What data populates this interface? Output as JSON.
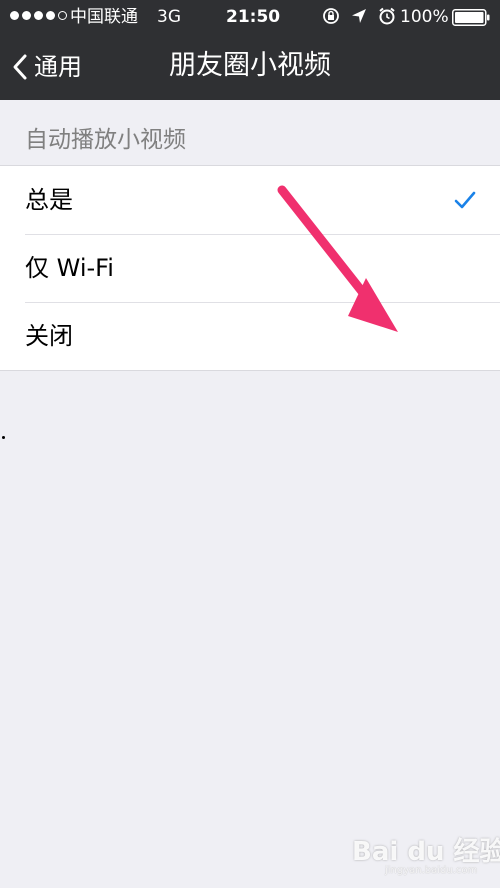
{
  "status_bar": {
    "carrier": "中国联通",
    "network": "3G",
    "time": "21:50",
    "battery_percent": "100%",
    "signal_strength": {
      "filled": 4,
      "total": 5
    },
    "icons": [
      "rotation-lock-icon",
      "location-arrow-icon",
      "alarm-icon",
      "battery-icon"
    ]
  },
  "nav": {
    "back_label": "通用",
    "title": "朋友圈小视频"
  },
  "section": {
    "header": "自动播放小视频",
    "options": [
      {
        "label": "总是",
        "selected": true
      },
      {
        "label": "仅 Wi-Fi",
        "selected": false
      },
      {
        "label": "关闭",
        "selected": false
      }
    ]
  },
  "annotation": {
    "arrow_color": "#f0306e"
  },
  "watermark": {
    "brand": "Bai du 经验",
    "url": "jingyan.baidu.com"
  },
  "colors": {
    "nav_bg": "#2f3033",
    "page_bg": "#efeff4",
    "check_color": "#1a82e8",
    "section_header_color": "#808080"
  }
}
